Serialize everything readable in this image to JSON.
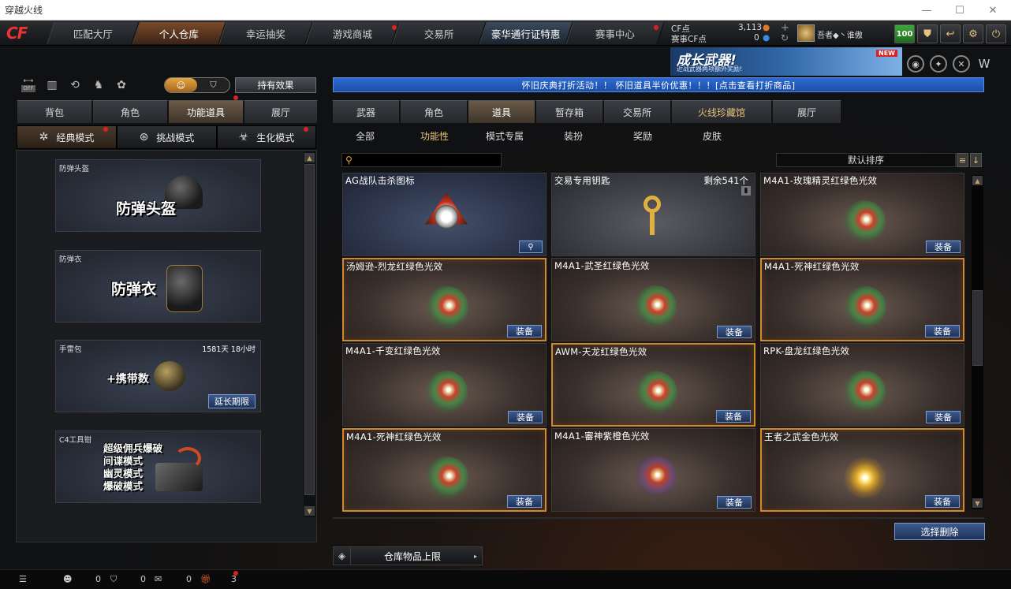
{
  "window": {
    "title": "穿越火线"
  },
  "logo": "CF",
  "nav": {
    "tabs": [
      "匹配大厅",
      "个人仓库",
      "幸运抽奖",
      "游戏商城",
      "交易所",
      "豪华通行证特惠",
      "赛事中心"
    ]
  },
  "currency": {
    "cf_label": "CF点",
    "cf_value": "3,113",
    "event_label": "赛事CF点",
    "event_value": "0"
  },
  "user": {
    "name": "吾者◆丶谁傲",
    "level": "100"
  },
  "banner": {
    "title": "成长武器!",
    "subtitle": "近战武器两项额外奖励!",
    "badge": "NEW"
  },
  "left": {
    "toggle_off": "OFF",
    "effect_button": "持有效果",
    "tabs": [
      "背包",
      "角色",
      "功能道具",
      "展厅"
    ],
    "active_tab": 2,
    "modes": [
      "经典模式",
      "挑战模式",
      "生化模式"
    ],
    "slots": [
      {
        "label": "防弹头盔",
        "big": "防弹头盔"
      },
      {
        "label": "防弹衣",
        "big": "防弹衣"
      },
      {
        "label": "手雷包",
        "big": "+携带数",
        "time": "1581天 18小时",
        "button": "延长期限"
      },
      {
        "label": "C4工具钳",
        "lines": [
          "超级佣兵爆破",
          "间谍模式",
          "幽灵模式",
          "爆破模式"
        ]
      }
    ]
  },
  "main": {
    "announcement": "怀旧庆典打折活动！！ 怀旧道具半价优惠！！！[点击查看打折商品]",
    "tabs": [
      "武器",
      "角色",
      "道具",
      "暂存箱",
      "交易所",
      "火线珍藏馆",
      "展厅"
    ],
    "active_tab": 2,
    "subtabs": [
      "全部",
      "功能性",
      "模式专属",
      "装扮",
      "奖励",
      "皮肤"
    ],
    "active_subtab": 1,
    "search_placeholder": "",
    "sort_label": "默认排序",
    "equip_label": "装备",
    "items": [
      {
        "name": "AG战队击杀图标",
        "style": "blue",
        "fx": "skull"
      },
      {
        "name": "交易专用钥匙",
        "count": "剩余541个",
        "style": "grey",
        "fx": "key"
      },
      {
        "name": "M4A1-玫瑰精灵红绿色光效",
        "style": "normal",
        "fx": "rg",
        "equip": true
      },
      {
        "name": "汤姆逊-烈龙红绿色光效",
        "style": "sel",
        "fx": "rg",
        "equip": true
      },
      {
        "name": "M4A1-武圣红绿色光效",
        "style": "normal",
        "fx": "rg",
        "equip": true
      },
      {
        "name": "M4A1-死神红绿色光效",
        "style": "sel",
        "fx": "rg",
        "equip": true
      },
      {
        "name": "M4A1-千变红绿色光效",
        "style": "normal",
        "fx": "rg",
        "equip": true
      },
      {
        "name": "AWM-天龙红绿色光效",
        "style": "sel",
        "fx": "rg",
        "equip": true
      },
      {
        "name": "RPK-盘龙红绿色光效",
        "style": "normal",
        "fx": "rg",
        "equip": true
      },
      {
        "name": "M4A1-死神红绿色光效",
        "style": "sel",
        "fx": "rg",
        "equip": true
      },
      {
        "name": "M4A1-審神紫橙色光效",
        "style": "normal",
        "fx": "rp",
        "equip": true
      },
      {
        "name": "王者之武金色光效",
        "style": "sel",
        "fx": "gold",
        "equip": true
      }
    ],
    "delete_button": "选择删除",
    "capacity_label": "仓库物品上限"
  },
  "bottom": {
    "friends": "0",
    "shield": "0",
    "chat": "0",
    "gifts": "3"
  }
}
